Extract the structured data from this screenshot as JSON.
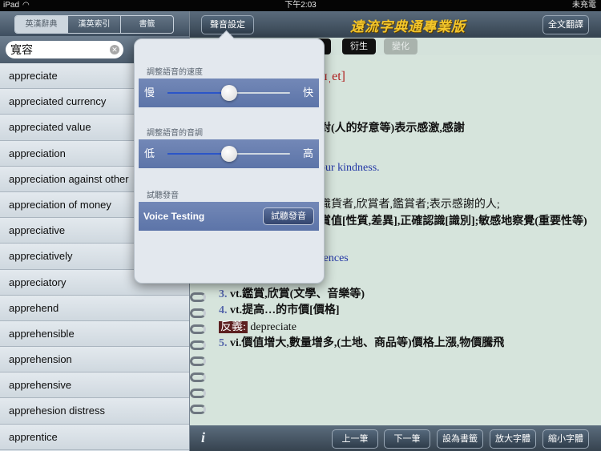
{
  "status_bar": {
    "carrier": "iPad",
    "wifi_icon": "wifi-icon",
    "time": "下午2:03",
    "battery": "未充電"
  },
  "sidebar": {
    "segments": [
      {
        "label": "英漢辭典",
        "active": true
      },
      {
        "label": "漢英索引",
        "active": false
      },
      {
        "label": "書籤",
        "active": false
      }
    ],
    "search": {
      "value": "寬容",
      "clear_icon": "clear-icon"
    },
    "words": [
      "appreciate",
      "appreciated currency",
      "appreciated value",
      "appreciation",
      "appreciation against other",
      "appreciation of money",
      "appreciative",
      "appreciatively",
      "appreciatory",
      "apprehend",
      "apprehensible",
      "apprehension",
      "apprehensive",
      "apprehesion distress",
      "apprentice"
    ]
  },
  "header": {
    "sound_settings": "聲音設定",
    "title": "遠流字典通專業版",
    "full_translate": "全文翻譯"
  },
  "tabs": [
    {
      "label": "義",
      "style": "dark"
    },
    {
      "label": "衍生",
      "style": "dark"
    },
    {
      "label": "變化",
      "style": "disabled"
    }
  ],
  "entry": {
    "phonetic": "ʃɪˌet]",
    "line_def1": "對(人的好意等)表示感激,感謝",
    "line_example1": "our kindness.",
    "line_def2": "識貨者,欣賞者,鑑賞者;表示感謝的人;",
    "line_def3": "賞值[性質,差異],正確認識[識別];敏感地察覺(重要性等)",
    "line_example2": "rences",
    "sense3_num": "3.",
    "sense3": "vt.鑑賞,欣賞(文學、音樂等)",
    "sense4_num": "4.",
    "sense4": "vt.提高…的市價[價格]",
    "antonym_label": "反義:",
    "antonym_word": "depreciate",
    "sense5_num": "5.",
    "sense5": "vi.價值增大,數量增多,(土地、商品等)價格上漲,物價騰飛"
  },
  "bottom": {
    "info_icon": "info-icon",
    "info_glyph": "i",
    "prev": "上一筆",
    "next": "下一筆",
    "bookmark": "設為書籤",
    "zoom_in": "放大字體",
    "zoom_out": "縮小字體"
  },
  "popover": {
    "speed_label": "調整語音的速度",
    "speed_low": "慢",
    "speed_high": "快",
    "speed_value": 0.5,
    "pitch_label": "調整語音的音調",
    "pitch_low": "低",
    "pitch_high": "高",
    "pitch_value": 0.5,
    "test_label": "試聽發音",
    "voice_testing": "Voice Testing",
    "test_button": "試聽發音"
  }
}
